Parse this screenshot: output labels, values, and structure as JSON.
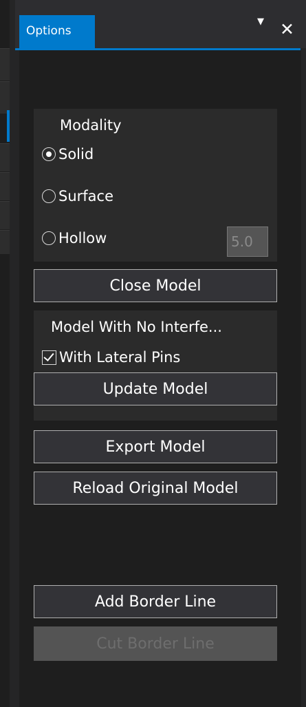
{
  "tab": {
    "title": "Options",
    "menu_icon": "▼",
    "close_icon": "✕"
  },
  "modality": {
    "title": "Modality",
    "options": [
      {
        "label": "Solid",
        "selected": true
      },
      {
        "label": "Surface",
        "selected": false
      },
      {
        "label": "Hollow",
        "selected": false
      }
    ],
    "hollow_value": "5.0"
  },
  "buttons": {
    "close_model": "Close Model",
    "update_model": "Update Model",
    "export_model": "Export Model",
    "reload_original_model": "Reload Original Model",
    "add_border_line": "Add Border Line",
    "cut_border_line": "Cut Border Line"
  },
  "interference": {
    "title": "Model With No Interfe...",
    "lateral_pins": {
      "label": "With Lateral Pins",
      "checked": true
    }
  },
  "colors": {
    "accent": "#007acc",
    "background": "#1e1e1e",
    "group_background": "#2b2b2b",
    "button_background": "#333337",
    "button_border": "#b0b0b0",
    "disabled": "#545454"
  }
}
